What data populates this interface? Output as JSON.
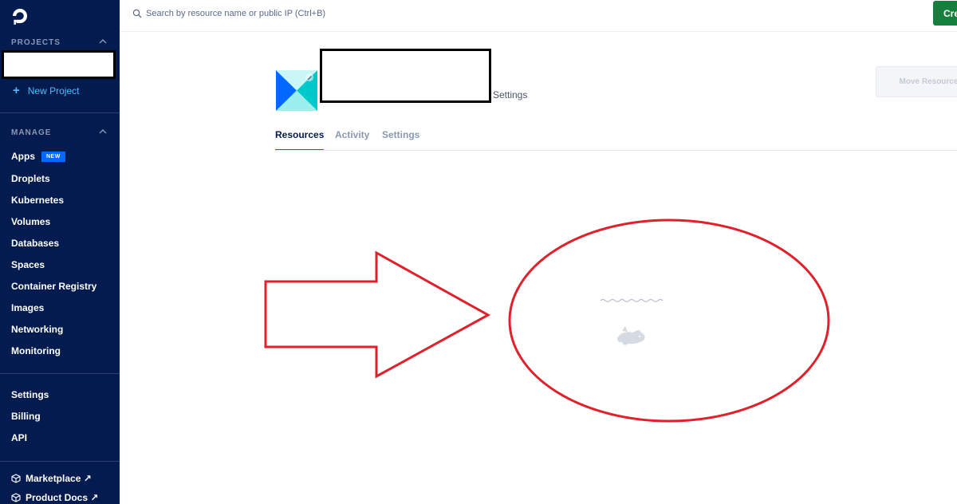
{
  "sidebar": {
    "projects_header": "PROJECTS",
    "new_project_label": "New Project",
    "manage_header": "MANAGE",
    "manage_items": [
      {
        "label": "Apps",
        "badge": "NEW"
      },
      {
        "label": "Droplets"
      },
      {
        "label": "Kubernetes"
      },
      {
        "label": "Volumes"
      },
      {
        "label": "Databases"
      },
      {
        "label": "Spaces"
      },
      {
        "label": "Container Registry"
      },
      {
        "label": "Images"
      },
      {
        "label": "Networking"
      },
      {
        "label": "Monitoring"
      }
    ],
    "account_items": [
      {
        "label": "Settings"
      },
      {
        "label": "Billing"
      },
      {
        "label": "API"
      }
    ],
    "external_items": [
      {
        "label": "Marketplace ↗",
        "icon": "cube-icon"
      },
      {
        "label": "Product Docs ↗",
        "icon": "cube-icon"
      }
    ]
  },
  "topbar": {
    "search_placeholder": "Search by resource name or public IP (Ctrl+B)",
    "create_label": "Create"
  },
  "project": {
    "settings_link": "Settings",
    "move_button_label": "Move Resources"
  },
  "tabs": [
    {
      "label": "Resources",
      "active": true
    },
    {
      "label": "Activity",
      "active": false
    },
    {
      "label": "Settings",
      "active": false
    }
  ],
  "colors": {
    "sidebar_bg": "#031b4e",
    "accent_blue": "#0069ff",
    "link_blue": "#49c1ff",
    "create_green": "#15803d",
    "annotation_red": "#e0202a"
  }
}
